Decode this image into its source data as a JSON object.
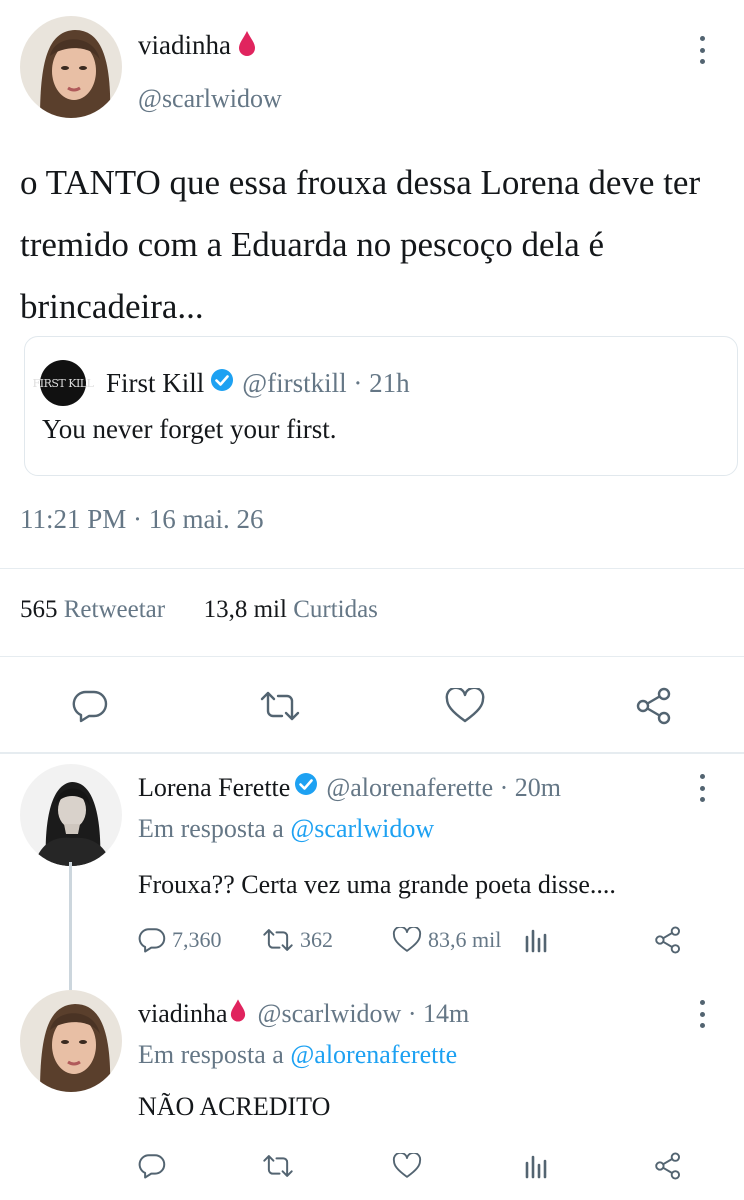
{
  "main_tweet": {
    "display_name": "viadinha",
    "handle": "@scarlwidow",
    "text": "o TANTO que essa frouxa dessa Lorena deve ter tremido com a Eduarda no pescoço dela é brincadeira...",
    "timestamp": "11:21 PM · 16 mai. 26",
    "retweets_count": "565",
    "retweets_label": "Retweetar",
    "likes_count": "13,8 mil",
    "likes_label": "Curtidas",
    "quoted": {
      "logo_text": "FIRST KILL",
      "display_name": "First Kill",
      "handle_time": "@firstkill · 21h",
      "text": "You never forget your first."
    },
    "actions": [
      "reply-icon",
      "retweet-icon",
      "like-icon",
      "share-icon"
    ]
  },
  "replies": [
    {
      "display_name": "Lorena Ferette",
      "handle_time": "@alorenaferette · 20m",
      "reply_prefix": "Em resposta a",
      "reply_to": "@scarlwidow",
      "text": "Frouxa?? Certa vez uma grande poeta disse....",
      "reply_count": "7,360",
      "retweet_count": "362",
      "like_count": "83,6 mil",
      "verified": true
    },
    {
      "display_name": "viadinha",
      "handle_time": "@scarlwidow · 14m",
      "reply_prefix": "Em resposta a",
      "reply_to": "@alorenaferette",
      "text": "NÃO ACREDITO"
    }
  ],
  "colors": {
    "accent": "#1da1f2",
    "muted": "#657786",
    "text": "#14171a",
    "blood_drop": "#e0245e"
  }
}
